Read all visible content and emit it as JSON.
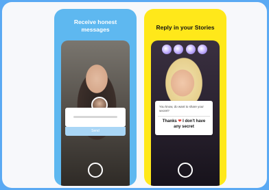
{
  "cards": {
    "blue": {
      "title_line1": "Receive honest",
      "title_line2": "messages",
      "reply_placeholder": "",
      "send_label": "Send"
    },
    "yellow": {
      "title": "Reply in your Stories",
      "question": "You know, do want to share your secret?",
      "answer_pre": "Thanks ",
      "answer_emoji": "❤",
      "answer_post": " I don't have any secret"
    }
  },
  "colors": {
    "background": "#5aa9f3",
    "blue_card": "#5eb8f0",
    "yellow_card": "#ffe81a"
  }
}
